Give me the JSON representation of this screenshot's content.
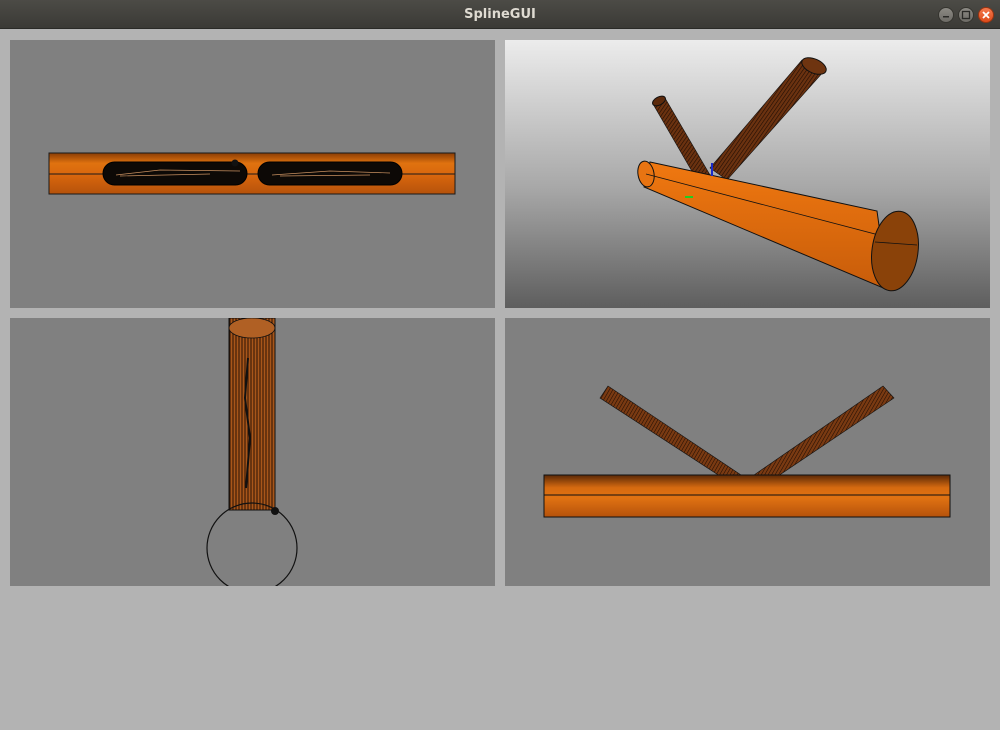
{
  "window": {
    "title": "SplineGUI",
    "controls": [
      "minimize-icon",
      "maximize-icon",
      "close-icon"
    ]
  },
  "viewports": [
    {
      "id": "top",
      "label": ""
    },
    {
      "id": "perspective",
      "label": ""
    },
    {
      "id": "side",
      "label": ""
    },
    {
      "id": "front",
      "label": ""
    }
  ],
  "colors": {
    "pipe_orange": "#d4640f",
    "pipe_dark": "#3a1a06",
    "viewport_bg": "#808080",
    "window_bg": "#b3b3b3",
    "titlebar": "#43423e",
    "axis_blue": "#1a2cc8",
    "axis_green": "#22cc22"
  }
}
